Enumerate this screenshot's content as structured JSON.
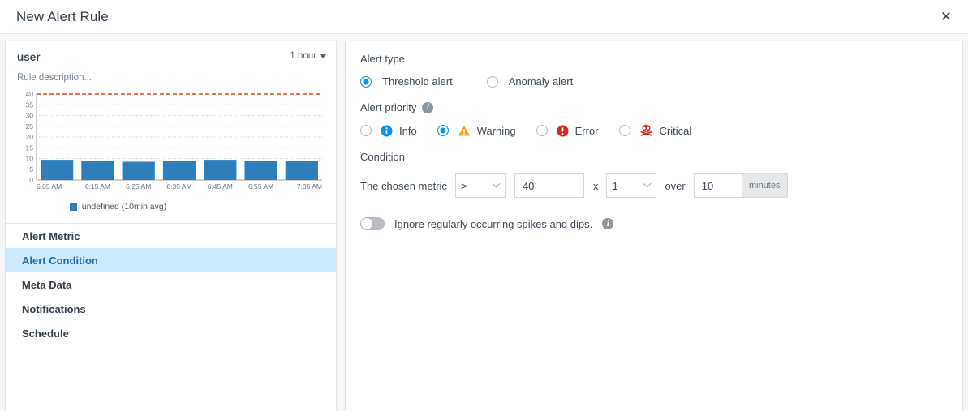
{
  "header": {
    "title": "New Alert Rule",
    "close_icon": "close-icon"
  },
  "left_panel": {
    "metric_name": "user",
    "time_range": "1 hour",
    "rule_description": "Rule description...",
    "nav_items": [
      {
        "label": "Alert Metric",
        "active": false
      },
      {
        "label": "Alert Condition",
        "active": true
      },
      {
        "label": "Meta Data",
        "active": false
      },
      {
        "label": "Notifications",
        "active": false
      },
      {
        "label": "Schedule",
        "active": false
      }
    ]
  },
  "chart_data": {
    "type": "bar",
    "title": "user",
    "xlabel": "",
    "ylabel": "",
    "categories": [
      "6:05 AM",
      "6:15 AM",
      "6:25 AM",
      "6:35 AM",
      "6:45 AM",
      "6:55 AM",
      "7:05 AM"
    ],
    "values": [
      9.4,
      8.9,
      8.5,
      9.0,
      9.4,
      9.0,
      9.0
    ],
    "ylim": [
      0,
      40
    ],
    "yticks": [
      0,
      5,
      10,
      15,
      20,
      25,
      30,
      35,
      40
    ],
    "grid": true,
    "legend": [
      {
        "name": "undefined (10min avg)",
        "color": "#2e7ebb"
      }
    ],
    "legend_position": "bottom",
    "threshold_line": {
      "value": 40,
      "color": "#e8401c",
      "style": "dashed"
    },
    "bar_color": "#2e7ebb"
  },
  "right_panel": {
    "alert_type": {
      "section_label": "Alert type",
      "options": [
        {
          "label": "Threshold alert",
          "selected": true
        },
        {
          "label": "Anomaly alert",
          "selected": false
        }
      ]
    },
    "alert_priority": {
      "section_label": "Alert priority",
      "info_icon": "info-icon",
      "options": [
        {
          "label": "Info",
          "selected": false,
          "icon": "info-badge-icon",
          "color": "#0b93e8"
        },
        {
          "label": "Warning",
          "selected": true,
          "icon": "warning-triangle-icon",
          "color": "#f5a623"
        },
        {
          "label": "Error",
          "selected": false,
          "icon": "error-badge-icon",
          "color": "#d8271c"
        },
        {
          "label": "Critical",
          "selected": false,
          "icon": "skull-crossbones-icon",
          "color": "#d8271c"
        }
      ]
    },
    "condition": {
      "section_label": "Condition",
      "prefix_text": "The chosen metric",
      "operator": ">",
      "threshold_value": "40",
      "times_text": "x",
      "multiplier": "1",
      "over_text": "over",
      "duration_value": "10",
      "duration_unit": "minutes"
    },
    "ignore_spikes": {
      "label": "Ignore regularly occurring spikes and dips.",
      "enabled": false,
      "info_icon": "info-icon"
    }
  }
}
